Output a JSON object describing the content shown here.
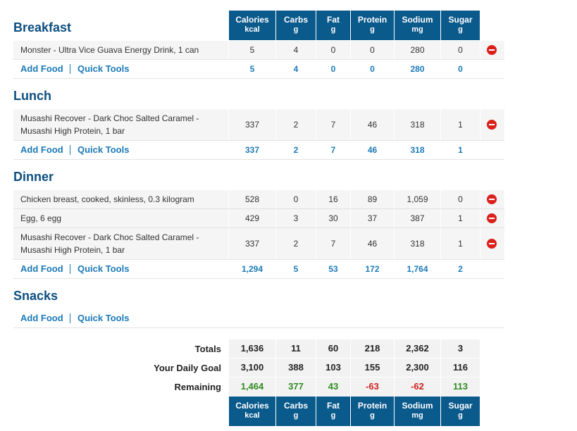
{
  "columns": [
    {
      "label": "Calories",
      "unit": "kcal"
    },
    {
      "label": "Carbs",
      "unit": "g"
    },
    {
      "label": "Fat",
      "unit": "g"
    },
    {
      "label": "Protein",
      "unit": "g"
    },
    {
      "label": "Sodium",
      "unit": "mg"
    },
    {
      "label": "Sugar",
      "unit": "g"
    }
  ],
  "links": {
    "add_food": "Add Food",
    "quick_tools": "Quick Tools"
  },
  "meals": [
    {
      "title": "Breakfast",
      "items": [
        {
          "name_lines": [
            "Monster - Ultra Vice Guava Energy Drink, 1 can"
          ],
          "values": [
            "5",
            "4",
            "0",
            "0",
            "280",
            "0"
          ]
        }
      ],
      "totals": [
        "5",
        "4",
        "0",
        "0",
        "280",
        "0"
      ]
    },
    {
      "title": "Lunch",
      "items": [
        {
          "name_lines": [
            "Musashi Recover - Dark Choc Salted Caramel -",
            "Musashi High Protein, 1 bar"
          ],
          "values": [
            "337",
            "2",
            "7",
            "46",
            "318",
            "1"
          ]
        }
      ],
      "totals": [
        "337",
        "2",
        "7",
        "46",
        "318",
        "1"
      ]
    },
    {
      "title": "Dinner",
      "items": [
        {
          "name_lines": [
            "Chicken breast, cooked, skinless, 0.3 kilogram"
          ],
          "values": [
            "528",
            "0",
            "16",
            "89",
            "1,059",
            "0"
          ]
        },
        {
          "name_lines": [
            "Egg, 6 egg"
          ],
          "values": [
            "429",
            "3",
            "30",
            "37",
            "387",
            "1"
          ]
        },
        {
          "name_lines": [
            "Musashi Recover - Dark Choc Salted Caramel -",
            "Musashi High Protein, 1 bar"
          ],
          "values": [
            "337",
            "2",
            "7",
            "46",
            "318",
            "1"
          ]
        }
      ],
      "totals": [
        "1,294",
        "5",
        "53",
        "172",
        "1,764",
        "2"
      ]
    },
    {
      "title": "Snacks",
      "items": [],
      "totals": []
    }
  ],
  "summary": [
    {
      "label": "Totals",
      "values": [
        "1,636",
        "11",
        "60",
        "218",
        "2,362",
        "3"
      ],
      "kind": "plain"
    },
    {
      "label": "Your Daily Goal",
      "values": [
        "3,100",
        "388",
        "103",
        "155",
        "2,300",
        "116"
      ],
      "kind": "plain"
    },
    {
      "label": "Remaining",
      "values": [
        "1,464",
        "377",
        "43",
        "-63",
        "-62",
        "113"
      ],
      "kind": "remaining"
    }
  ],
  "colors": {
    "header_bg": "#0b5a8c",
    "link": "#1b7ab8",
    "positive": "#2e8b1f",
    "negative": "#d21f1f",
    "delete": "#d9201c"
  }
}
